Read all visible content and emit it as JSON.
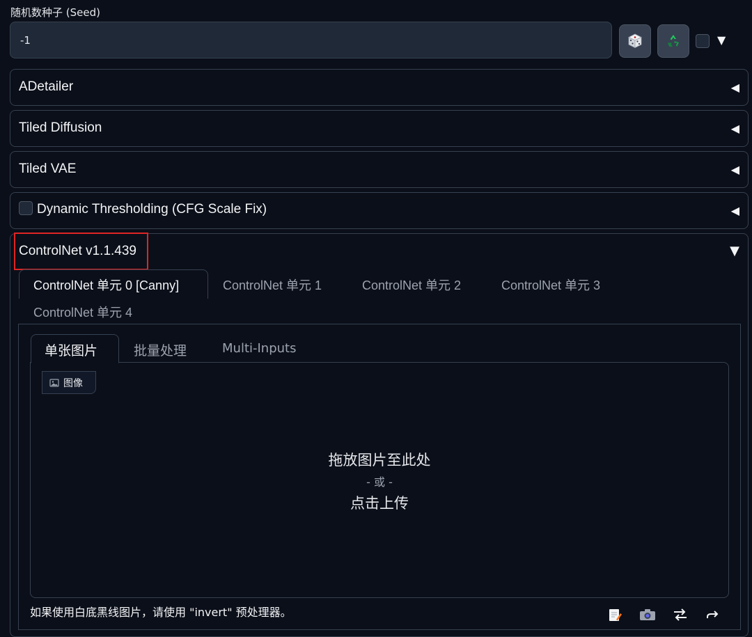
{
  "seed": {
    "label": "随机数种子 (Seed)",
    "value": "-1",
    "dice_icon": "dice-icon",
    "recycle_icon": "recycle-icon",
    "extra_toggle_icon": "triangle-down-icon"
  },
  "accordions": {
    "adetailer": {
      "label": "ADetailer",
      "arrow": "◀"
    },
    "tiled_diffusion": {
      "label": "Tiled Diffusion",
      "arrow": "◀"
    },
    "tiled_vae": {
      "label": "Tiled VAE",
      "arrow": "◀"
    },
    "dynamic_thresholding": {
      "label": "Dynamic Thresholding (CFG Scale Fix)",
      "arrow": "◀"
    },
    "controlnet": {
      "label": "ControlNet v1.1.439",
      "arrow": "▼"
    }
  },
  "controlnet": {
    "units": [
      {
        "label": "ControlNet 单元 0 [Canny]"
      },
      {
        "label": "ControlNet 单元 1"
      },
      {
        "label": "ControlNet 单元 2"
      },
      {
        "label": "ControlNet 单元 3"
      },
      {
        "label": "ControlNet 单元 4"
      }
    ],
    "sub_tabs": [
      {
        "label": "单张图片"
      },
      {
        "label": "批量处理"
      },
      {
        "label": "Multi-Inputs"
      }
    ],
    "image_chip_label": "图像",
    "drop": {
      "line1": "拖放图片至此处",
      "line2": "- 或 -",
      "line3": "点击上传"
    },
    "hint": "如果使用白底黑线图片，请使用 \"invert\" 预处理器。",
    "tool_icons": [
      "edit-icon",
      "camera-icon",
      "swap-icon",
      "send-icon"
    ]
  },
  "colors": {
    "background": "#0b0f19",
    "border": "#374151",
    "highlight": "#e02424"
  }
}
